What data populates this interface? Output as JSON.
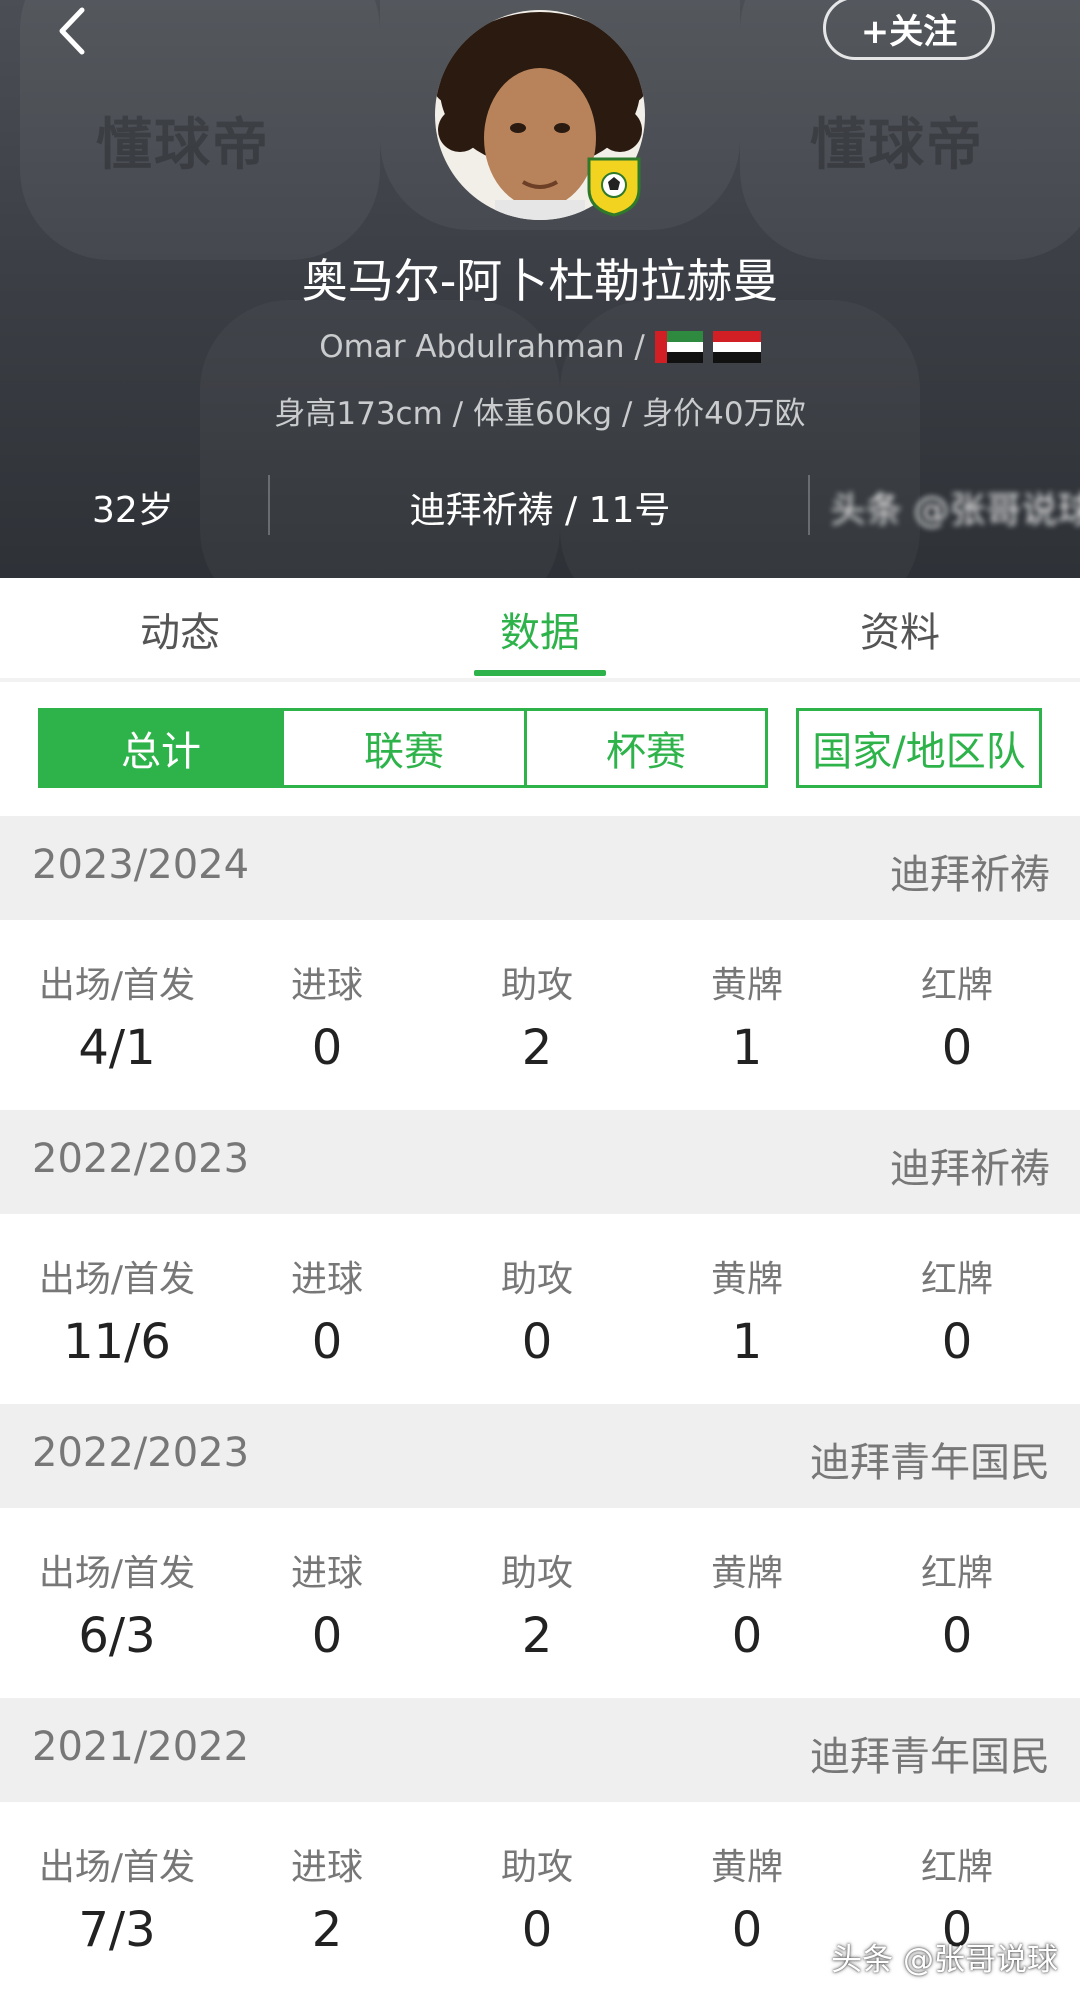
{
  "header": {
    "watermark_left": "懂球帝",
    "watermark_right": "懂球帝",
    "follow_label": "+关注",
    "player_name": "奥马尔-阿卜杜勒拉赫曼",
    "english_name": "Omar Abdulrahman /",
    "physical": "身高173cm / 体重60kg / 身价40万欧",
    "age": "32岁",
    "club_number": "迪拜祈祷 / 11号",
    "blurred_text": "头条 @张哥说球"
  },
  "tabs": [
    {
      "label": "动态"
    },
    {
      "label": "数据"
    },
    {
      "label": "资料"
    }
  ],
  "active_tab": "数据",
  "filters": [
    {
      "label": "总计"
    },
    {
      "label": "联赛"
    },
    {
      "label": "杯赛"
    },
    {
      "label": "国家/地区队"
    }
  ],
  "active_filter": "总计",
  "stat_labels": [
    "出场/首发",
    "进球",
    "助攻",
    "黄牌",
    "红牌"
  ],
  "seasons": [
    {
      "year": "2023/2024",
      "club": "迪拜祈祷",
      "values": [
        "4/1",
        "0",
        "2",
        "1",
        "0"
      ]
    },
    {
      "year": "2022/2023",
      "club": "迪拜祈祷",
      "values": [
        "11/6",
        "0",
        "0",
        "1",
        "0"
      ]
    },
    {
      "year": "2022/2023",
      "club": "迪拜青年国民",
      "values": [
        "6/3",
        "0",
        "2",
        "0",
        "0"
      ]
    },
    {
      "year": "2021/2022",
      "club": "迪拜青年国民",
      "values": [
        "7/3",
        "2",
        "0",
        "0",
        "0"
      ]
    }
  ],
  "footer_watermark": "头条 @张哥说球",
  "colors": {
    "accent": "#2db34a",
    "header_bg": "#3c4046"
  }
}
